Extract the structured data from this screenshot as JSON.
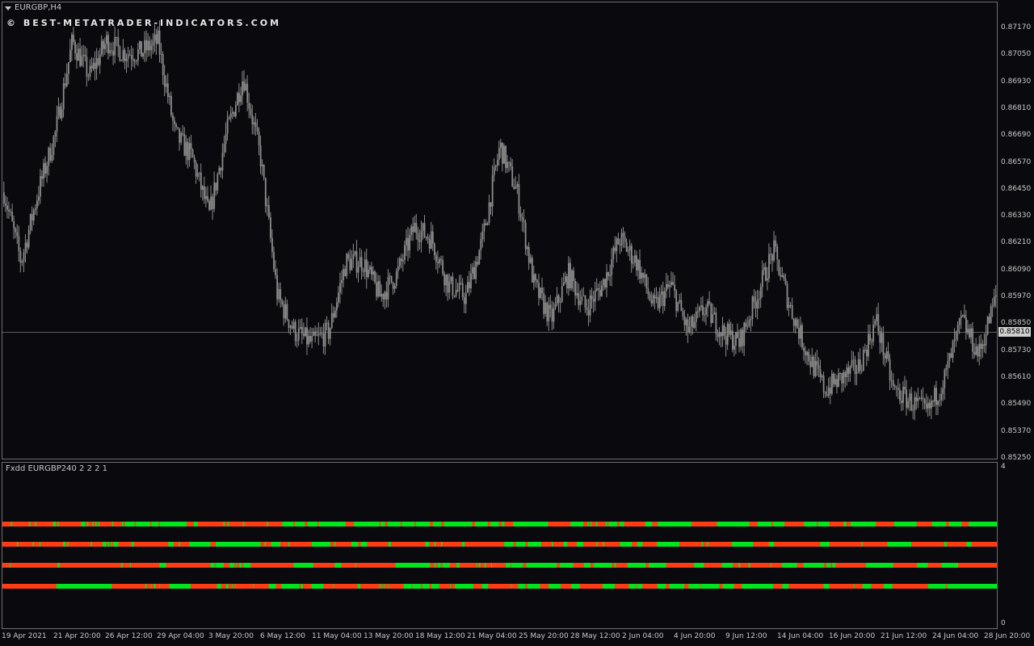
{
  "window": {
    "title": "EURGBP,H4",
    "watermark": "© BEST-METATRADER-INDICATORS.COM"
  },
  "price_axis": {
    "labels": [
      "0.87170",
      "0.87050",
      "0.86930",
      "0.86810",
      "0.86690",
      "0.86570",
      "0.86450",
      "0.86330",
      "0.86210",
      "0.86090",
      "0.85970",
      "0.85850",
      "0.85730",
      "0.85610",
      "0.85490",
      "0.85370",
      "0.85250"
    ],
    "current_price": "0.85810"
  },
  "time_axis": {
    "labels": [
      "19 Apr 2021",
      "21 Apr 20:00",
      "26 Apr 12:00",
      "29 Apr 04:00",
      "3 May 20:00",
      "6 May 12:00",
      "11 May 04:00",
      "13 May 20:00",
      "18 May 12:00",
      "21 May 04:00",
      "25 May 20:00",
      "28 May 12:00",
      "2 Jun 04:00",
      "4 Jun 20:00",
      "9 Jun 12:00",
      "14 Jun 04:00",
      "16 Jun 20:00",
      "21 Jun 12:00",
      "24 Jun 04:00",
      "28 Jun 20:00"
    ]
  },
  "indicator": {
    "title": "Fxdd EURGBP240 2 2 2 1",
    "scale_max": "4",
    "scale_min": "0"
  },
  "colors": {
    "candle": "#8c8c8c",
    "bull_strip": "#00e61e",
    "bear_strip": "#ff3c14"
  },
  "chart_data": {
    "type": "candlestick",
    "symbol": "EURGBP",
    "timeframe": "H4",
    "ylim": [
      0.8525,
      0.8722
    ],
    "close_path": [
      [
        0,
        0.864
      ],
      [
        3,
        0.861
      ],
      [
        6,
        0.864
      ],
      [
        9,
        0.8665
      ],
      [
        12,
        0.8705
      ],
      [
        15,
        0.869
      ],
      [
        18,
        0.8705
      ],
      [
        21,
        0.87
      ],
      [
        24,
        0.87
      ],
      [
        27,
        0.8705
      ],
      [
        30,
        0.8665
      ],
      [
        33,
        0.8655
      ],
      [
        36,
        0.863
      ],
      [
        39,
        0.8665
      ],
      [
        42,
        0.869
      ],
      [
        45,
        0.8655
      ],
      [
        48,
        0.8595
      ],
      [
        51,
        0.858
      ],
      [
        54,
        0.8575
      ],
      [
        57,
        0.858
      ],
      [
        60,
        0.861
      ],
      [
        63,
        0.861
      ],
      [
        66,
        0.8595
      ],
      [
        69,
        0.8605
      ],
      [
        72,
        0.8625
      ],
      [
        75,
        0.862
      ],
      [
        78,
        0.86
      ],
      [
        81,
        0.8595
      ],
      [
        84,
        0.862
      ],
      [
        87,
        0.866
      ],
      [
        90,
        0.864
      ],
      [
        93,
        0.86
      ],
      [
        96,
        0.8585
      ],
      [
        99,
        0.8605
      ],
      [
        102,
        0.859
      ],
      [
        105,
        0.86
      ],
      [
        108,
        0.862
      ],
      [
        111,
        0.861
      ],
      [
        114,
        0.859
      ],
      [
        117,
        0.86
      ],
      [
        120,
        0.858
      ],
      [
        123,
        0.859
      ],
      [
        126,
        0.858
      ],
      [
        129,
        0.8575
      ],
      [
        132,
        0.8595
      ],
      [
        135,
        0.8615
      ],
      [
        138,
        0.859
      ],
      [
        141,
        0.857
      ],
      [
        144,
        0.8555
      ],
      [
        147,
        0.856
      ],
      [
        150,
        0.8565
      ],
      [
        153,
        0.8585
      ],
      [
        156,
        0.8555
      ],
      [
        159,
        0.855
      ],
      [
        162,
        0.8545
      ],
      [
        165,
        0.856
      ],
      [
        168,
        0.8585
      ],
      [
        171,
        0.857
      ],
      [
        174,
        0.8595
      ]
    ],
    "strips": [
      {
        "row": 1,
        "start": "bear",
        "segments": [
          6,
          1,
          12,
          1,
          3,
          1,
          12,
          2,
          1,
          1,
          16,
          3,
          1,
          1,
          3,
          1,
          1,
          1,
          1,
          1,
          9,
          1,
          6,
          1,
          1,
          7,
          1,
          10,
          1,
          5,
          1,
          19,
          5,
          3,
          18,
          1,
          2,
          1,
          10,
          1,
          16,
          1,
          10,
          8,
          1,
          7,
          2,
          7,
          1,
          19,
          6,
          18,
          1,
          3,
          2,
          9,
          1,
          9,
          1,
          10,
          2,
          6,
          2,
          20,
          2,
          9,
          2,
          6,
          2,
          2,
          6,
          25,
          16,
          9,
          3,
          1,
          1,
          1,
          3,
          1,
          6,
          1,
          1,
          6,
          2,
          3,
          15,
          5,
          4,
          24,
          18,
          23,
          6,
          10,
          1,
          8,
          14,
          9,
          1,
          8,
          10,
          2,
          3,
          18,
          13,
          16,
          11,
          10,
          2,
          9,
          5,
          20
        ]
      },
      {
        "row": 2,
        "start": "bear",
        "segments": [
          11,
          1,
          11,
          1,
          4,
          1,
          17,
          2,
          1,
          1,
          17,
          1,
          8,
          3,
          1,
          1,
          1,
          1,
          1,
          4,
          10,
          2,
          26,
          4,
          4,
          1,
          7,
          16,
          4,
          34,
          3,
          1,
          4,
          7,
          6,
          1,
          17,
          14,
          3,
          1,
          12,
          5,
          2,
          5,
          16,
          2,
          26,
          3,
          4,
          1,
          4,
          1,
          15,
          2,
          30,
          7,
          2,
          7,
          2,
          10,
          8,
          1,
          8,
          3,
          7,
          5,
          10,
          1,
          4,
          1,
          12,
          9,
          4,
          4,
          11,
          17,
          17,
          1,
          3,
          1,
          18,
          16,
          12,
          4,
          35,
          7,
          24,
          1,
          19,
          18,
          25,
          2,
          15,
          4,
          19
        ]
      },
      {
        "row": 3,
        "start": "bear",
        "segments": [
          9,
          1,
          57,
          3,
          74,
          2,
          9,
          1,
          35,
          8,
          54,
          5,
          1,
          10,
          7,
          6,
          2,
          1,
          3,
          3,
          2,
          9,
          52,
          24,
          26,
          8,
          17,
          1,
          48,
          42,
          5,
          2,
          2,
          4,
          2,
          9,
          8,
          4,
          20,
          1,
          2,
          2,
          5,
          2,
          6,
          1,
          17,
          6,
          1,
          14,
          4,
          37,
          4,
          16,
          13,
          8,
          4,
          22,
          3,
          2,
          14,
          22,
          4,
          21,
          34,
          12,
          22,
          13,
          7,
          2,
          10,
          2,
          25,
          1,
          13,
          18,
          8,
          25,
          3,
          5,
          2,
          4,
          37,
          33,
          29,
          13,
          17,
          20,
          47
        ]
      },
      {
        "row": 4,
        "start": "bear",
        "segments": [
          76,
          78,
          47,
          2,
          6,
          1,
          3,
          3,
          5,
          1,
          13,
          30,
          37,
          6,
          7,
          3,
          5,
          1,
          3,
          1,
          25,
          1,
          21,
          10,
          8,
          25,
          2,
          3,
          12,
          17,
          14,
          1,
          33,
          4,
          26,
          1,
          1,
          1,
          2,
          1,
          2,
          1,
          4,
          1,
          21,
          11,
          1,
          12,
          2,
          10,
          3,
          11,
          15,
          1,
          6,
          26,
          12,
          9,
          32,
          1,
          9,
          10,
          3,
          18,
          12,
          17,
          15,
          12,
          32,
          17,
          20,
          10,
          1,
          8,
          21,
          12,
          5,
          21,
          6,
          17,
          1,
          25,
          5,
          16,
          11,
          44,
          13,
          9,
          49,
          8,
          35,
          1,
          11,
          12,
          18,
          12,
          50,
          25,
          2,
          70
        ]
      }
    ]
  }
}
